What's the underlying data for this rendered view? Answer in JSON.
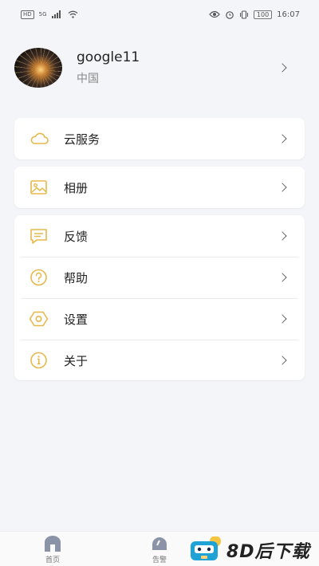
{
  "status_bar": {
    "hd": "HD",
    "network": "5G",
    "time": "16:07",
    "battery": "100"
  },
  "profile": {
    "name": "google11",
    "region": "中国"
  },
  "menu_groups": [
    [
      {
        "icon": "cloud-icon",
        "label": "云服务"
      }
    ],
    [
      {
        "icon": "photo-album-icon",
        "label": "相册"
      }
    ],
    [
      {
        "icon": "feedback-icon",
        "label": "反馈"
      },
      {
        "icon": "help-icon",
        "label": "帮助"
      },
      {
        "icon": "settings-icon",
        "label": "设置"
      },
      {
        "icon": "info-icon",
        "label": "关于"
      }
    ]
  ],
  "bottom_nav": [
    {
      "icon": "home-icon",
      "label": "首页"
    },
    {
      "icon": "alarm-icon",
      "label": "告警"
    }
  ],
  "watermark": {
    "text": "8D后下载"
  },
  "colors": {
    "accent": "#e6b84a",
    "background": "#f4f5f9",
    "card": "#ffffff"
  }
}
